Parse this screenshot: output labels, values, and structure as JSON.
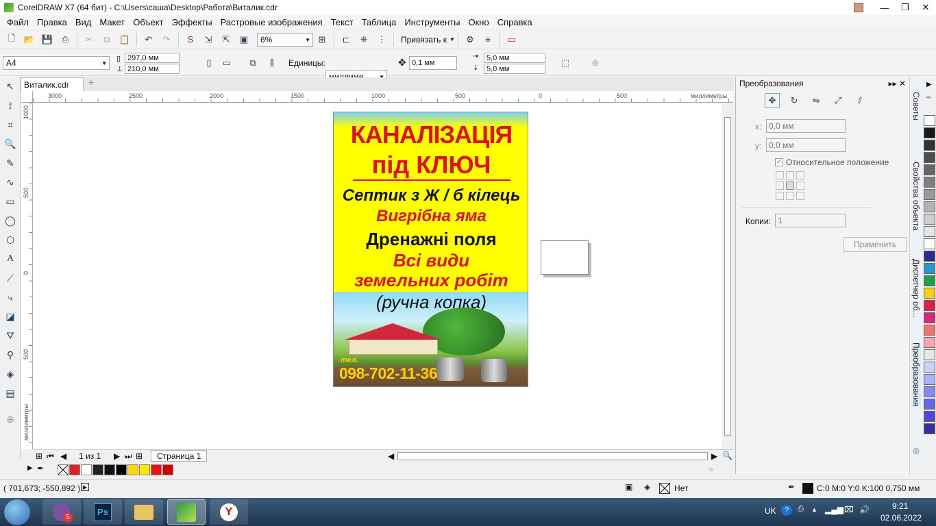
{
  "window": {
    "title": "CorelDRAW X7 (64 бит) - C:\\Users\\саша\\Desktop\\Работа\\Виталик.cdr",
    "minimize": "—",
    "restore": "❐",
    "close": "✕"
  },
  "menu": [
    "Файл",
    "Правка",
    "Вид",
    "Макет",
    "Объект",
    "Эффекты",
    "Растровые изображения",
    "Текст",
    "Таблица",
    "Инструменты",
    "Окно",
    "Справка"
  ],
  "toolbar": {
    "zoom": "6%",
    "snap": "Привязать к"
  },
  "property_bar": {
    "page_size": "A4",
    "width": "297,0 мм",
    "height": "210,0 мм",
    "units_label": "Единицы:",
    "units": "миллиме...",
    "nudge": "0,1 мм",
    "dup_x": "5,0 мм",
    "dup_y": "5,0 мм"
  },
  "doc_tab": "Виталик.cdr",
  "ruler": {
    "h_ticks": [
      "3000",
      "2500",
      "2000",
      "1500",
      "1000",
      "500",
      "0",
      "500"
    ],
    "h_unit": "миллиметры",
    "v_ticks": [
      "1000",
      "500",
      "0",
      "500"
    ],
    "v_unit": "миллиметры"
  },
  "poster": {
    "title1": "КАНАЛІЗАЦІЯ",
    "title2": "під КЛЮЧ",
    "line1": "Септик з Ж / б кілець",
    "line2": "Вигрібна  яма",
    "line3": "Дренажні  поля",
    "line4": "Всі види",
    "line5": "земельних робіт",
    "line6": "(ручна копка)",
    "tel_label": "тел.",
    "phone": "098-702-11-36"
  },
  "pagebar": {
    "page_count": "1 из 1",
    "page_tab": "Страница 1"
  },
  "palette_colors": [
    "#e02020",
    "#ffffff",
    "#222222",
    "#111111",
    "#000000",
    "#ffd700",
    "#ffe600",
    "#ee1111",
    "#cc0000",
    "#000000"
  ],
  "docker": {
    "title": "Преобразования",
    "x_label": "x:",
    "x_value": "0,0 мм",
    "y_label": "y:",
    "y_value": "0,0 мм",
    "relative": "Относительное положение",
    "copies_label": "Копии:",
    "copies_value": "1",
    "apply": "Применить"
  },
  "side_tabs": [
    "Советы",
    "Свойства объекта",
    "Диспетчер об...",
    "Преобразования"
  ],
  "right_palette": [
    "#ffffff",
    "#1a1a1a",
    "#333333",
    "#4d4d4d",
    "#666666",
    "#808080",
    "#999999",
    "#b3b3b3",
    "#cccccc",
    "#e6e6e6",
    "#ffffff",
    "#2b2b8f",
    "#1f9ad6",
    "#16a34a",
    "#facc15",
    "#e11d48",
    "#db2777",
    "#f87171",
    "#fda4af",
    "#e5e7eb",
    "#c7d2fe",
    "#a5b4fc",
    "#818cf8",
    "#6366f1",
    "#4f46e5",
    "#3730a3"
  ],
  "status": {
    "coords": "( 701,673; -550,892 )",
    "fill_none": "Нет",
    "outline": "C:0 M:0 Y:0 K:100  0,750 мм"
  },
  "taskbar": {
    "lang": "UK",
    "time": "9:21",
    "date": "02.06.2022",
    "viber_badge": "5"
  }
}
